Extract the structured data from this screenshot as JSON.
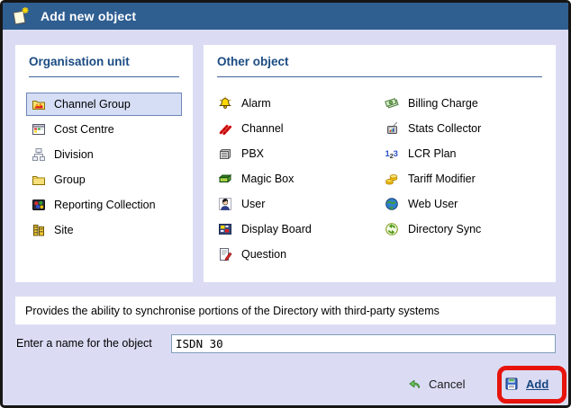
{
  "dialog": {
    "title": "Add new object",
    "icon": "new-document-sparkle-icon",
    "titlebar_color": "#2f5e91",
    "body_color": "#dbdcf4",
    "heading_color": "#1b4b82"
  },
  "organisation_unit": {
    "heading": "Organisation unit",
    "items": [
      {
        "label": "Channel Group",
        "icon": "channel-group-icon",
        "selected": true
      },
      {
        "label": "Cost Centre",
        "icon": "cost-centre-icon",
        "selected": false
      },
      {
        "label": "Division",
        "icon": "division-icon",
        "selected": false
      },
      {
        "label": "Group",
        "icon": "group-icon",
        "selected": false
      },
      {
        "label": "Reporting Collection",
        "icon": "reporting-collection-icon",
        "selected": false
      },
      {
        "label": "Site",
        "icon": "site-icon",
        "selected": false
      }
    ],
    "selection_bg": "#d6def6",
    "selection_border": "#6e86b8"
  },
  "other_object": {
    "heading": "Other object",
    "column1": [
      {
        "label": "Alarm",
        "icon": "alarm-bell-icon"
      },
      {
        "label": "Channel",
        "icon": "channel-icon"
      },
      {
        "label": "PBX",
        "icon": "pbx-icon"
      },
      {
        "label": "Magic Box",
        "icon": "magic-box-icon"
      },
      {
        "label": "User",
        "icon": "user-icon"
      },
      {
        "label": "Display Board",
        "icon": "display-board-icon"
      },
      {
        "label": "Question",
        "icon": "question-icon"
      }
    ],
    "column2": [
      {
        "label": "Billing Charge",
        "icon": "billing-charge-icon"
      },
      {
        "label": "Stats Collector",
        "icon": "stats-collector-icon"
      },
      {
        "label": "LCR Plan",
        "icon": "lcr-plan-icon"
      },
      {
        "label": "Tariff Modifier",
        "icon": "tariff-modifier-icon"
      },
      {
        "label": "Web User",
        "icon": "web-user-icon"
      },
      {
        "label": "Directory Sync",
        "icon": "directory-sync-icon"
      }
    ]
  },
  "description": "Provides the ability to synchronise portions of the Directory with third-party systems",
  "name_field": {
    "label": "Enter a name for the object",
    "value": "ISDN 30"
  },
  "actions": {
    "cancel_label": "Cancel",
    "cancel_icon": "undo-arrow-icon",
    "add_label": "Add",
    "add_icon": "floppy-disk-icon",
    "highlight_color": "#e6140c"
  }
}
